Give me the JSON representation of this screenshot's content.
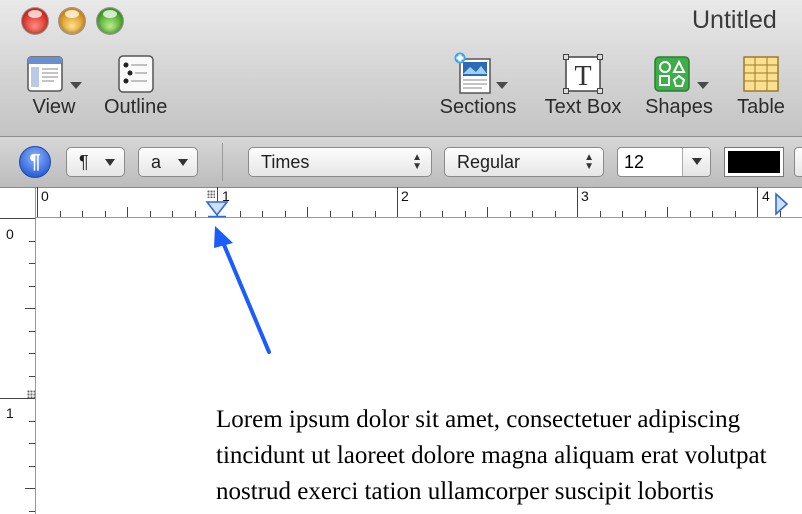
{
  "window": {
    "title": "Untitled"
  },
  "toolbar": {
    "view": "View",
    "outline": "Outline",
    "sections": "Sections",
    "textbox": "Text Box",
    "shapes": "Shapes",
    "table": "Table"
  },
  "formatbar": {
    "pilcrow": "¶",
    "paragraph_style": "¶",
    "char_style": "a",
    "font_family": "Times",
    "font_typeface": "Regular",
    "font_size": "12",
    "text_color": "#000000"
  },
  "ruler": {
    "h_numbers": [
      "0",
      "1",
      "2",
      "3",
      "4"
    ],
    "v_numbers": [
      "0",
      "1"
    ]
  },
  "document": {
    "lines": [
      "Lorem ipsum dolor sit amet, consectetuer adipiscing",
      "tincidunt ut laoreet dolore magna aliquam erat volutpat",
      "nostrud exerci tation ullamcorper suscipit lobortis"
    ]
  },
  "colors": {
    "accent": "#2c61d8",
    "annotation_arrow": "#1a5cff"
  }
}
